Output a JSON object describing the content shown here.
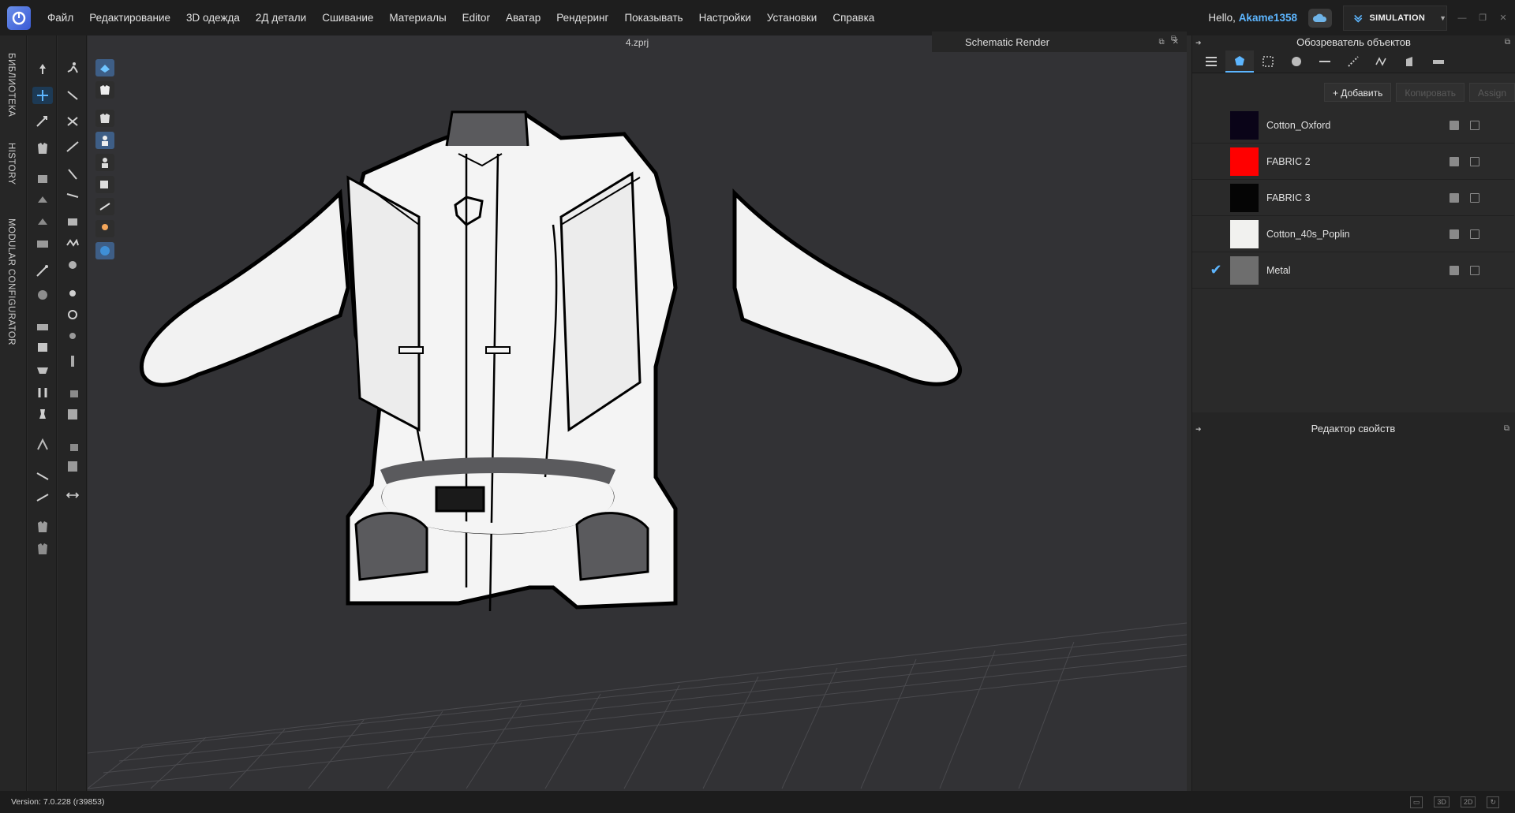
{
  "menubar": {
    "items": [
      "Файл",
      "Редактирование",
      "3D одежда",
      "2Д детали",
      "Сшивание",
      "Материалы",
      "Editor",
      "Аватар",
      "Рендеринг",
      "Показывать",
      "Настройки",
      "Установки",
      "Справка"
    ],
    "hello_prefix": "Hello,",
    "username": "Akame1358",
    "mode_label": "SIMULATION"
  },
  "sidebar_tabs": [
    "БИБЛИОТЕКА",
    "HISTORY",
    "MODULAR CONFIGURATOR"
  ],
  "viewport": {
    "file_title": "4.zprj",
    "schematic_tab": "Schematic Render"
  },
  "object_browser": {
    "title": "Обозреватель объектов",
    "add_label": "+ Добавить",
    "copy_label": "Копировать",
    "assign_label": "Assign",
    "fabrics": [
      {
        "name": "Cotton_Oxford",
        "color": "#0a0418",
        "checked": false
      },
      {
        "name": "FABRIC 2",
        "color": "#ff0000",
        "checked": false
      },
      {
        "name": "FABRIC 3",
        "color": "#050505",
        "checked": false
      },
      {
        "name": "Cotton_40s_Poplin",
        "color": "#f1f1ef",
        "checked": false
      },
      {
        "name": "Metal",
        "color": "#6e6e6e",
        "checked": true
      }
    ]
  },
  "property_editor": {
    "title": "Редактор свойств"
  },
  "status": {
    "version": "Version: 7.0.228 (r39853)"
  },
  "colors": {
    "accent": "#5db6ff",
    "viewport_bg": "#323235"
  }
}
